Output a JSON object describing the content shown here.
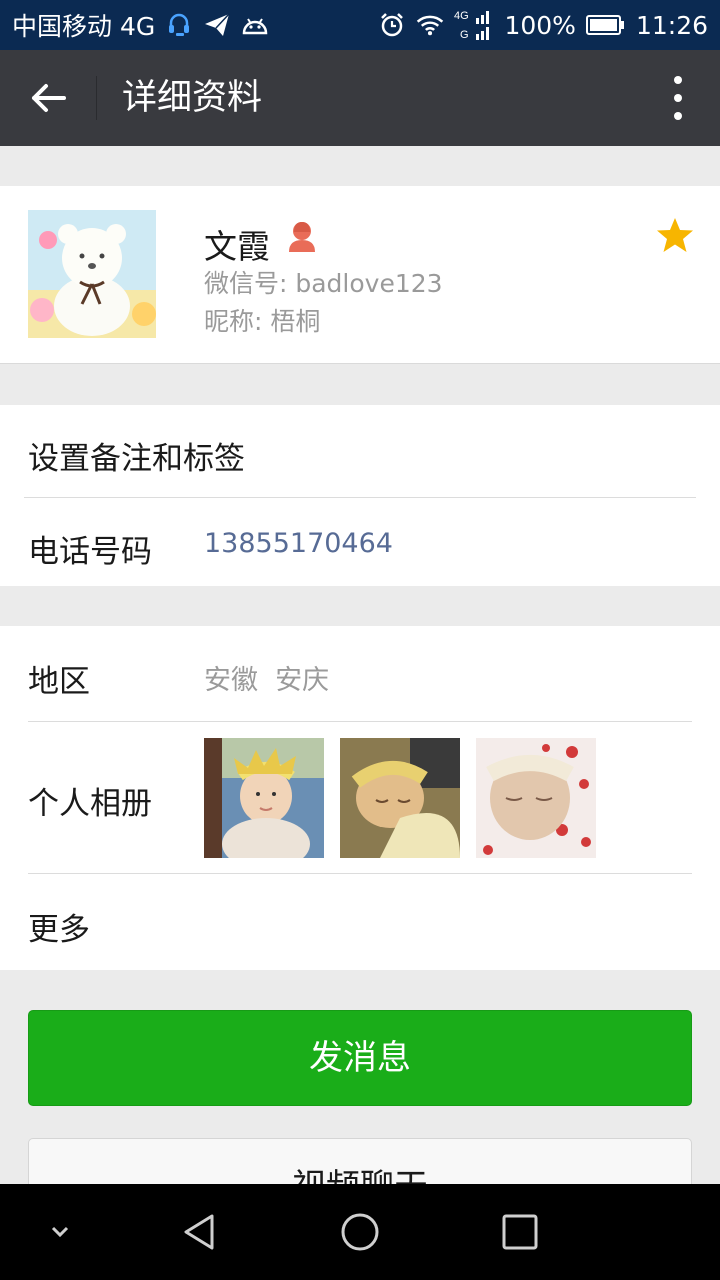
{
  "status_bar": {
    "carrier": "中国移动 4G",
    "signal_label": "4G",
    "battery": "100%",
    "time": "11:26"
  },
  "header": {
    "title": "详细资料"
  },
  "profile": {
    "name": "文霞",
    "wechat_id": "微信号: badlove123",
    "nickname": "昵称: 梧桐"
  },
  "contact": {
    "remark_label": "设置备注和标签",
    "phone_label": "电话号码",
    "phone_value": "13855170464"
  },
  "details": {
    "region_label": "地区",
    "region_value": "安徽  安庆",
    "album_label": "个人相册",
    "more_label": "更多"
  },
  "actions": {
    "send_message": "发消息",
    "video_chat": "视频聊天"
  },
  "colors": {
    "accent_green": "#1aad19",
    "header_bg": "#393a3f",
    "phone_link": "#576b95",
    "star": "#f7b500",
    "gender_icon": "#e96c58"
  }
}
